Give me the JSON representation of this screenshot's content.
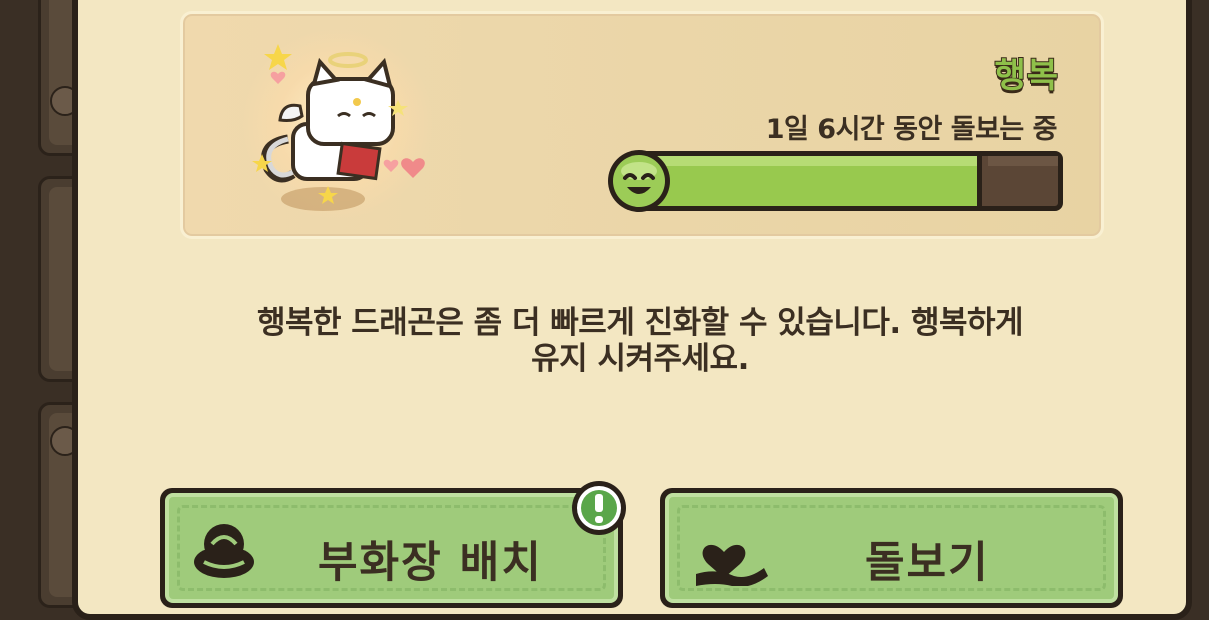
{
  "happiness_card": {
    "title": "행복",
    "care_status": "1일 6시간 동안 돌보는 중",
    "happiness_level": 0.82
  },
  "description": {
    "line1": "행복한 드래곤은 좀 더 빠르게 진화할 수 있습니다. 행복하게",
    "line2": "유지 시켜주세요."
  },
  "buttons": {
    "place_incubator": "부화장 배치",
    "care": "돌보기"
  },
  "icons": {
    "meter_face": "smiley-face-icon",
    "incubator": "incubator-nest-icon",
    "care": "heart-in-hand-icon",
    "alert": "exclamation-badge-icon"
  },
  "colors": {
    "panel_bg": "#f3e7c2",
    "accent_green": "#98c94e",
    "button_green": "#9fcb7b",
    "outline": "#2a2119",
    "text": "#3b2f22"
  }
}
